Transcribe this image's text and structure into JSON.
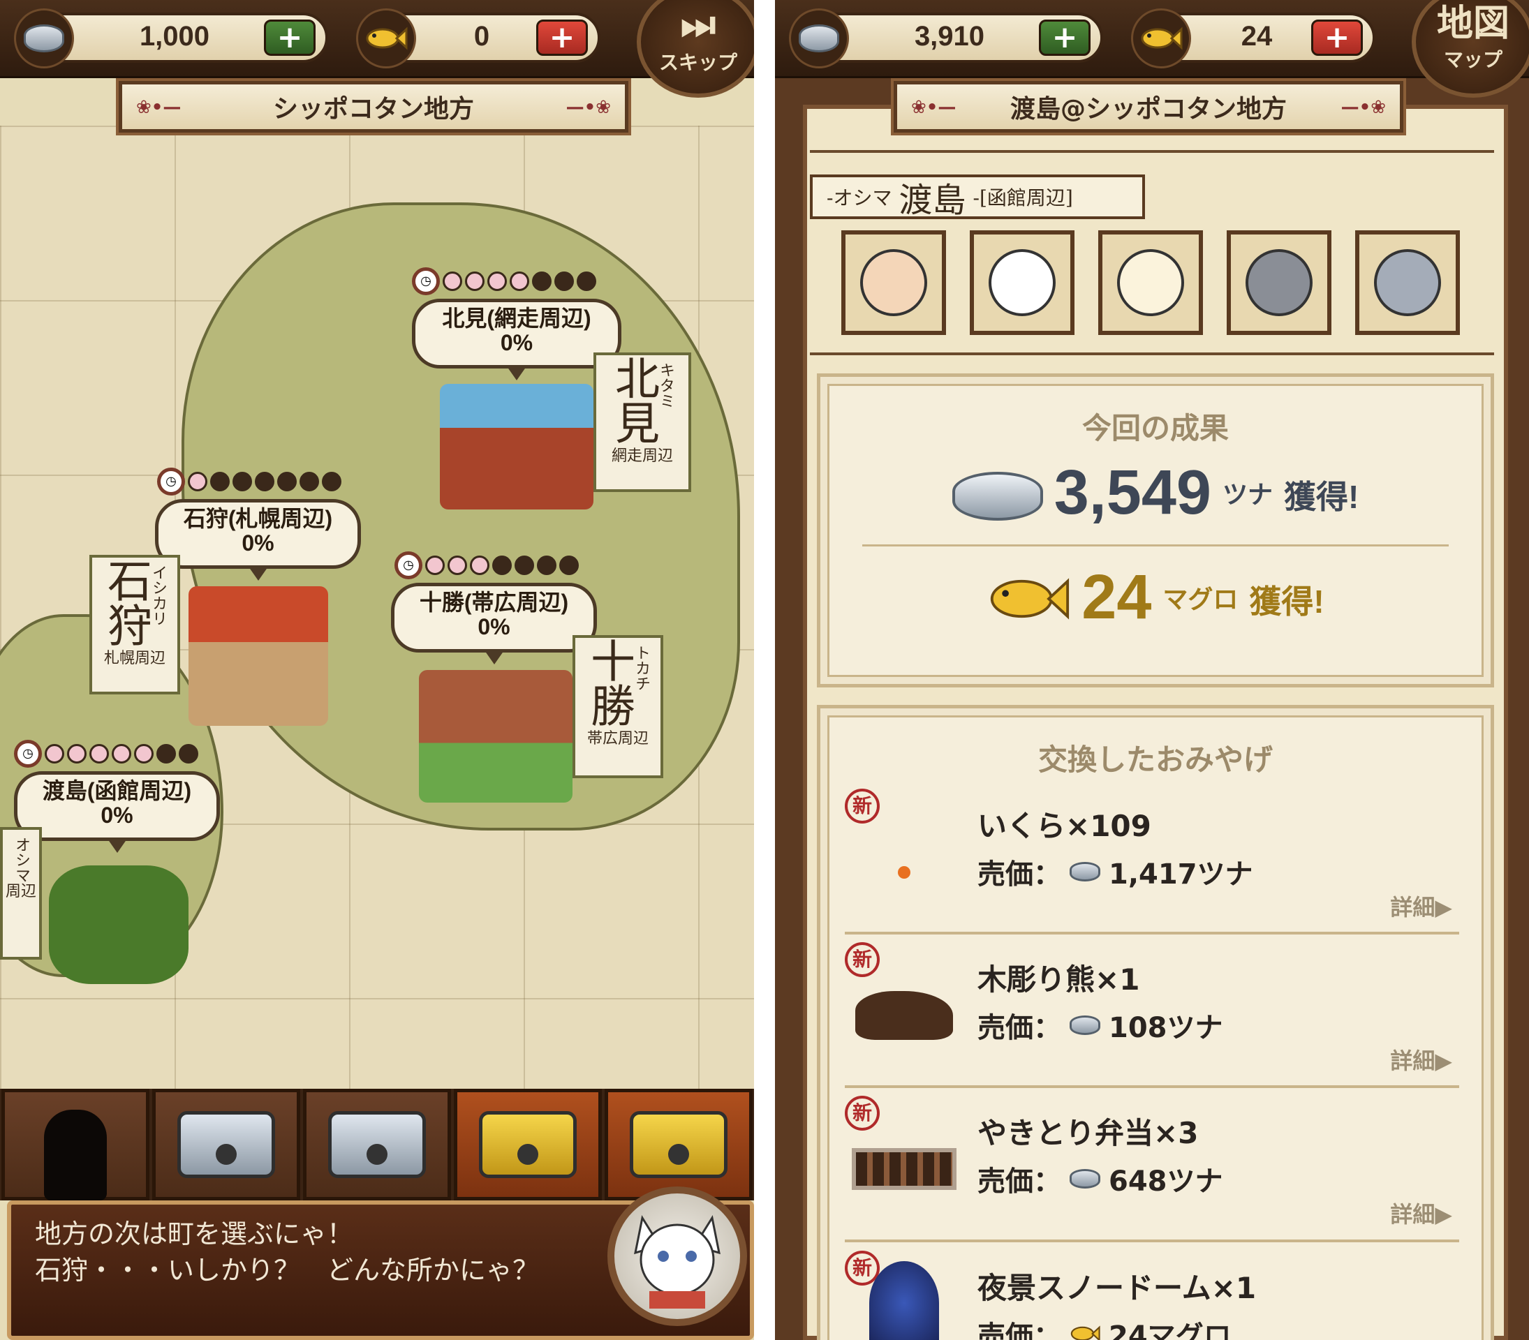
{
  "left": {
    "header": {
      "tuna_count": "1,000",
      "fish_count": "0",
      "skip_icon": "⏭",
      "skip_label": "スキップ"
    },
    "title": "シッポコタン地方",
    "regions": [
      {
        "name": "北見(網走周辺)",
        "percent": "0%",
        "stamp_big": "北見",
        "stamp_kana": "キタミ",
        "stamp_sub": "網走周辺"
      },
      {
        "name": "石狩(札幌周辺)",
        "percent": "0%",
        "stamp_big": "石狩",
        "stamp_kana": "イシカリ",
        "stamp_sub": "札幌周辺"
      },
      {
        "name": "十勝(帯広周辺)",
        "percent": "0%",
        "stamp_big": "十勝",
        "stamp_kana": "トカチ",
        "stamp_sub": "帯広周辺"
      },
      {
        "name": "渡島(函館周辺)",
        "percent": "0%",
        "stamp_kana": "オシマ",
        "stamp_sub": "周辺"
      }
    ],
    "dialog": {
      "line1": "地方の次は町を選ぶにゃ！",
      "line2": "石狩・・・いしかり？　どんな所かにゃ？"
    }
  },
  "right": {
    "header": {
      "tuna_count": "3,910",
      "fish_count": "24",
      "map_label_top": "地図",
      "map_label_bottom": "マップ"
    },
    "title": "渡島@シッポコタン地方",
    "area_tag": {
      "kana": "-オシマ",
      "kanji": "渡島",
      "sub": "-[函館周辺]"
    },
    "results": {
      "title": "今回の成果",
      "tuna_value": "3,549",
      "tuna_unit": "ツナ",
      "fish_value": "24",
      "fish_unit": "マグロ",
      "gained": "獲得!"
    },
    "souvenirs": {
      "title": "交換したおみやげ",
      "new_badge": "新",
      "price_label": "売価：",
      "detail_label": "詳細▶",
      "items": [
        {
          "name": "いくら×109",
          "price": "1,417ツナ"
        },
        {
          "name": "木彫り熊×1",
          "price": "108ツナ"
        },
        {
          "name": "やきとり弁当×3",
          "price": "648ツナ"
        },
        {
          "name": "夜景スノードーム×1",
          "price": "24マグロ"
        }
      ]
    }
  },
  "colors": {
    "wood_dark": "#3b2413",
    "parchment": "#f0e6c8",
    "plus_green": "#2f5d22",
    "plus_red": "#a82a22",
    "gold": "#a07a18"
  }
}
